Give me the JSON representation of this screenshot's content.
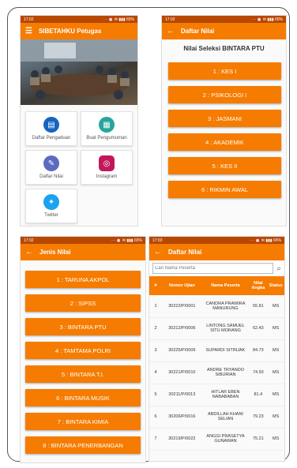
{
  "p1": {
    "status_time": "17:02",
    "status_icons": "⋯ ⏰ ✉ ▮▮▮ 65%",
    "menu_icon": "menu-icon",
    "title": "SIBETAHKU Petugas",
    "tiles": [
      {
        "label": "Daftar Pengaduan",
        "icon": "complaint-icon",
        "color": "#1565c0"
      },
      {
        "label": "Buat Pengumuman",
        "icon": "announcement-icon",
        "color": "#26a69a"
      },
      {
        "label": "Daftar Nilai",
        "icon": "grades-icon",
        "color": "#5c6bc0"
      },
      {
        "label": "Instagram",
        "icon": "instagram-icon",
        "color": "#c2185b"
      },
      {
        "label": "Twitter",
        "icon": "twitter-icon",
        "color": "#1da1f2"
      }
    ]
  },
  "p2": {
    "status_time": "17:02",
    "status_icons": "⋯ ⏰ ✉ ▮▮▮ 65%",
    "back_icon": "back-arrow-icon",
    "title": "Daftar Nilai",
    "heading": "Nilai Seleksi BINTARA PTU",
    "buttons": [
      "1 : KES I",
      "2 : PSIKOLOGI I",
      "3 : JASMANI",
      "4 : AKADEMIK",
      "5 : KES II",
      "6 : RIKMIN AWAL"
    ]
  },
  "p3": {
    "status_time": "17:02",
    "status_icons": "⋯ ⏰ ✉ ▮▮▮ 65%",
    "title": "Jenis Nilai",
    "buttons": [
      "1 : TARUNA AKPOL",
      "2 : SIPSS",
      "3 : BINTARA PTU",
      "4 : TAMTAMA POLRI",
      "5 : BINTARA T.I.",
      "6 : BINTARA MUSIK",
      "7 : BINTARA KIMIA",
      "8 : BINTARA PENERBANGAN"
    ]
  },
  "p4": {
    "status_time": "17:03",
    "status_icons": "⋯ ⏰ ✉ ▮▮▮ 65%",
    "title": "Daftar Nilai",
    "search_placeholder": "Cari Nama Peserta",
    "headers": [
      "#",
      "Nomor Ujian",
      "Nama Peserta",
      "Nilai Angka",
      "Status"
    ],
    "rows": [
      [
        "1",
        "30222/P/0001",
        "CANDRA PRAWIRA MANURUNG",
        "55.81",
        "MS"
      ],
      [
        "2",
        "30212/P/0006",
        "LINTONG SAMUEL SITU MORANG",
        "62.43",
        "MS"
      ],
      [
        "3",
        "30225/P/0009",
        "SUPARDI SITINJAK",
        "84.73",
        "MS"
      ],
      [
        "4",
        "30221/P/0010",
        "ANDRE TRYANDO SIBURIAN",
        "74.93",
        "MS"
      ],
      [
        "5",
        "30211/P/0013",
        "HITLAR EBEN NABABABAN",
        "81.4",
        "MS"
      ],
      [
        "6",
        "30206/P/0016",
        "ABDILLAH KHANI SELIAN",
        "79.23",
        "MS"
      ],
      [
        "7",
        "30219/P/0022",
        "ANGGI PRASETYA GUNAWAN",
        "75.21",
        "MS"
      ]
    ]
  }
}
